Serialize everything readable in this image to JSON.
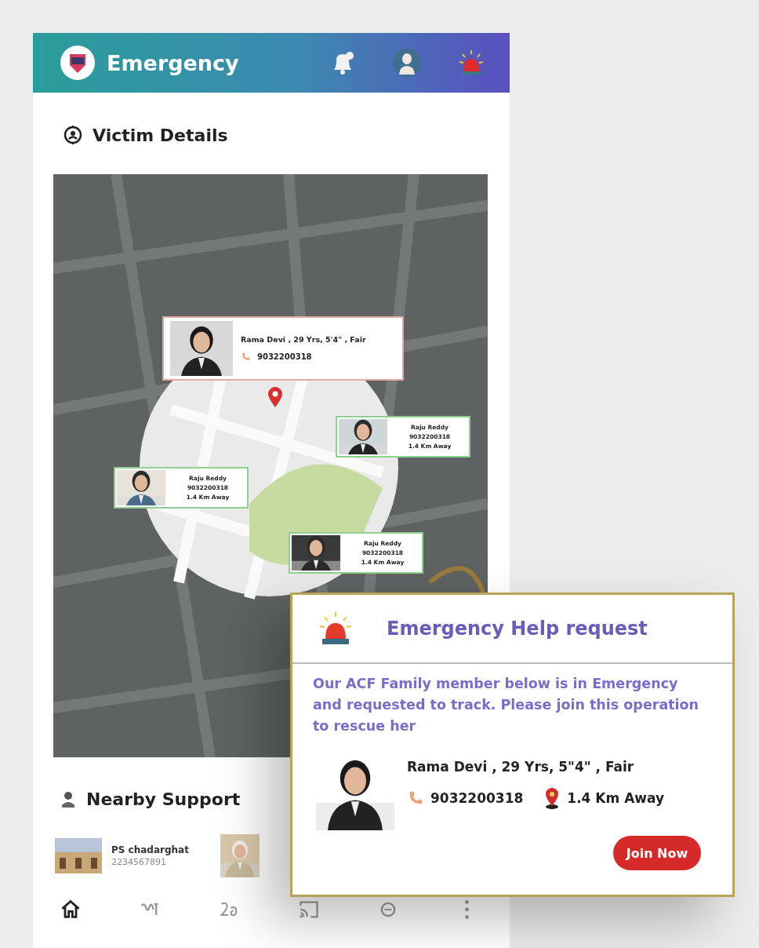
{
  "app_bar": {
    "title": "Emergency"
  },
  "victim_section": {
    "title": "Victim Details"
  },
  "map": {
    "kind": "picture",
    "victim_card": {
      "name_line": "Rama Devi , 29 Yrs, 5'4\" , Fair",
      "phone": "9032200318"
    },
    "helpers": [
      {
        "name": "Raju Reddy",
        "phone": "9032200318",
        "distance": "1.4 Km Away"
      },
      {
        "name": "Raju Reddy",
        "phone": "9032200318",
        "distance": "1.4 Km Away"
      },
      {
        "name": "Raju Reddy",
        "phone": "9032200318",
        "distance": "1.4 Km Away"
      }
    ]
  },
  "nearby": {
    "title": "Nearby Support",
    "items": [
      {
        "kind": "station",
        "name": "PS chadarghat",
        "phone": "2234567891"
      },
      {
        "kind": "person"
      }
    ]
  },
  "bottom_nav": [
    {
      "kind": "home",
      "selected": true
    },
    {
      "kind": "script",
      "selected": false
    },
    {
      "kind": "script-alt",
      "selected": false
    },
    {
      "kind": "cast",
      "selected": false
    },
    {
      "kind": "circle",
      "selected": false
    },
    {
      "kind": "more",
      "selected": false
    }
  ],
  "popup": {
    "title": "Emergency Help request",
    "message": "Our ACF Family member below is in Emergency and requested to track. Please join this operation to rescue her",
    "person": {
      "name_line": "Rama Devi , 29 Yrs, 5\"4\"  , Fair",
      "phone": "9032200318",
      "distance": "1.4 Km Away"
    },
    "button": "Join Now"
  }
}
